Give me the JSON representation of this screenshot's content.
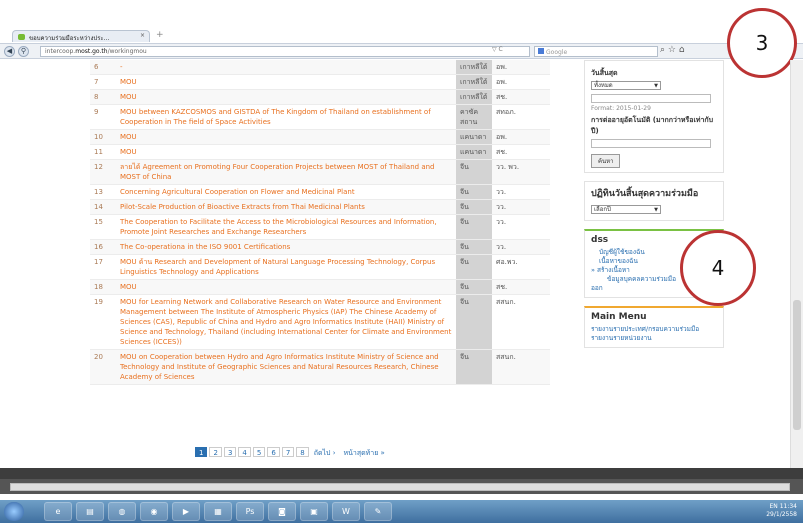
{
  "browser": {
    "tab_title": "ขอบความร่วมมือระหว่างประ...",
    "tab_close": "×",
    "new_tab": "+",
    "url_prefix": "intercoop.",
    "url_domain": "most.go.th",
    "url_path": "/workingmou",
    "url_controls": "▽ C",
    "search_placeholder": "Google",
    "toolbar_icons": "⌕ ☆ ⌂"
  },
  "table": {
    "rows": [
      {
        "num": "6",
        "title": "-",
        "country": "เกาหลีใต้",
        "agency": "อพ."
      },
      {
        "num": "7",
        "title": "MOU",
        "country": "เกาหลีใต้",
        "agency": "อพ."
      },
      {
        "num": "8",
        "title": "MOU",
        "country": "เกาหลีใต้",
        "agency": "สช."
      },
      {
        "num": "9",
        "title": "MOU between KAZCOSMOS and GISTDA of The Kingdom of Thailand on establishment of Cooperation in The field of Space Activities",
        "country": "คาซัคสถาน",
        "agency": "สทอภ."
      },
      {
        "num": "10",
        "title": "MOU",
        "country": "แคนาดา",
        "agency": "อพ."
      },
      {
        "num": "11",
        "title": "MOU",
        "country": "แคนาดา",
        "agency": "สช."
      },
      {
        "num": "12",
        "title": "ลายได้ Agreement on Promoting Four Cooperation Projects between MOST of Thailand and MOST of China",
        "country": "จีน",
        "agency": "วว. พว."
      },
      {
        "num": "13",
        "title": "Concerning Agricultural Cooperation on Flower and Medicinal Plant",
        "country": "จีน",
        "agency": "วว."
      },
      {
        "num": "14",
        "title": "Pilot-Scale Production of Bioactive Extracts from Thai Medicinal Plants",
        "country": "จีน",
        "agency": "วว."
      },
      {
        "num": "15",
        "title": "The Cooperation to Facilitate the Access to the Microbiological Resources and Information, Promote Joint Researches and Exchange Researchers",
        "country": "จีน",
        "agency": "วว."
      },
      {
        "num": "16",
        "title": "The Co-operationa in the ISO 9001 Certifications",
        "country": "จีน",
        "agency": "วว."
      },
      {
        "num": "17",
        "title": "MOU ด้าน Research and Development of Natural Language Processing Technology, Corpus Linguistics Technology and Applications",
        "country": "จีน",
        "agency": "ศอ.พว."
      },
      {
        "num": "18",
        "title": "MOU",
        "country": "จีน",
        "agency": "สช."
      },
      {
        "num": "19",
        "title": "MOU for Learning Network and Collaborative Research on Water Resource and Environment Management between The Institute of Atmospheric Physics (IAP) The Chinese Academy of Sciences (CAS), Republic of China and Hydro and Agro Informatics Institute (HAII) Ministry of Science and Technology, Thailand (including International Center for Climate and Environment Sciences (ICCES))",
        "country": "จีน",
        "agency": "สสนก."
      },
      {
        "num": "20",
        "title": "MOU on Cooperation between Hydro and Agro Informatics Institute Ministry of Science and Technology and Institute of Geographic Sciences and Natural Resources Research, Chinese Academy of Sciences",
        "country": "จีน",
        "agency": "สสนก."
      }
    ]
  },
  "pager": {
    "pages": [
      "1",
      "2",
      "3",
      "4",
      "5",
      "6",
      "7",
      "8"
    ],
    "next": "ถัดไป ›",
    "last": "หน้าสุดท้าย »"
  },
  "sidebar": {
    "filter": {
      "heading": "วันสิ้นสุด",
      "select_value": "ทั้งหมด",
      "format_hint": "Format: 2015-01-29",
      "extension_label": "การต่ออายุอัตโนมัติ (มากกว่าหรือเท่ากับ ปี)",
      "submit": "ค้นหา"
    },
    "calendar": {
      "heading": "ปฏิทินวันสิ้นสุดความร่วมมือ",
      "select_value": "เลือกปี"
    },
    "dss": {
      "heading": "dss",
      "links": [
        "บัญชีผู้ใช้ของฉัน",
        "เนื้อหาของฉัน",
        "สร้างเนื้อหา",
        "ข้อมูลบุคคลความร่วมมือ",
        "ออก"
      ]
    },
    "main_menu": {
      "heading": "Main Menu",
      "links": [
        "รายงานรายประเทศ/กรอบความร่วมมือ",
        "รายงานรายหน่วยงาน"
      ]
    }
  },
  "annotations": {
    "circle_3": "3",
    "circle_4": "4"
  },
  "taskbar": {
    "tray_lang": "EN",
    "time": "11:34",
    "date": "29/1/2558"
  }
}
